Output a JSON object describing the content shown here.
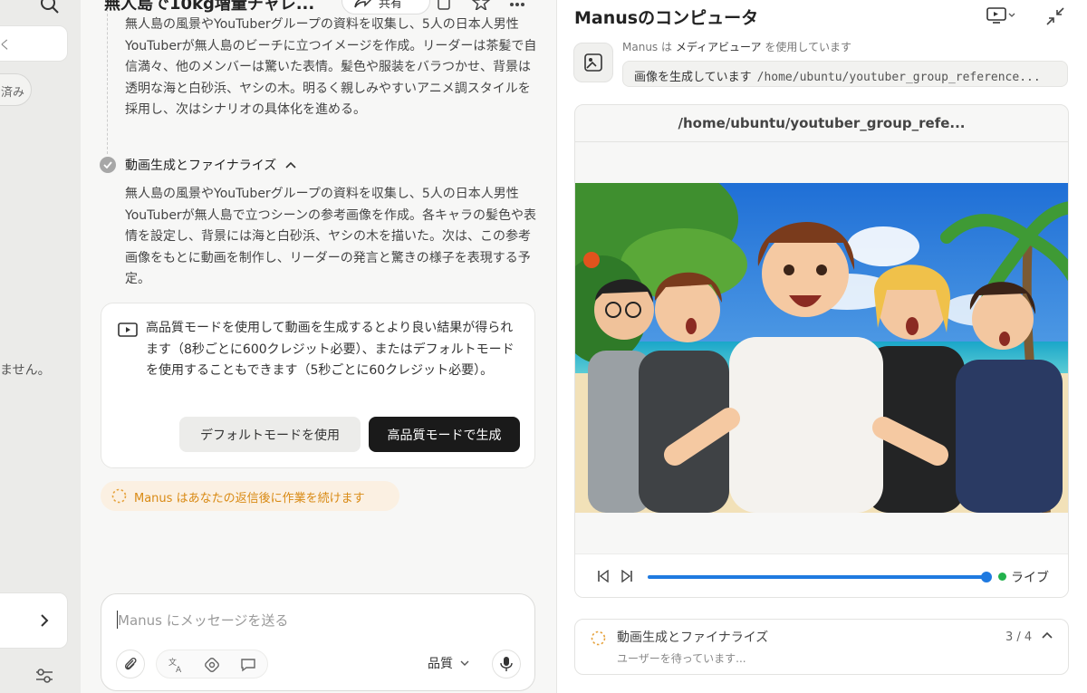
{
  "sidebar": {
    "input_fragment": "く",
    "chip_fragment": "済み",
    "empty_fragment": "ません。"
  },
  "chat": {
    "title": "無人島で10kg増量チャレ...",
    "share_label": "共有",
    "paragraph1": "無人島の風景やYouTuberグループの資料を収集し、5人の日本人男性YouTuberが無人島のビーチに立つイメージを作成。リーダーは茶髪で自信満々、他のメンバーは驚いた表情。髪色や服装をバラつかせ、背景は透明な海と白砂浜、ヤシの木。明るく親しみやすいアニメ調スタイルを採用し、次はシナリオの具体化を進める。",
    "step_label": "動画生成とファイナライズ",
    "paragraph2": "無人島の風景やYouTuberグループの資料を収集し、5人の日本人男性YouTuberが無人島で立つシーンの参考画像を作成。各キャラの髪色や表情を設定し、背景には海と白砂浜、ヤシの木を描いた。次は、この参考画像をもとに動画を制作し、リーダーの発言と驚きの様子を表現する予定。",
    "notice": {
      "text": "高品質モードを使用して動画を生成するとより良い結果が得られます（8秒ごとに600クレジット必要）、またはデフォルトモードを使用することもできます（5秒ごとに60クレジット必要）。",
      "default_button": "デフォルトモードを使用",
      "hq_button": "高品質モードで生成"
    },
    "waiting": "Manus はあなたの返信後に作業を続けます",
    "composer": {
      "placeholder": "Manus にメッセージを送る",
      "quality_label": "品質"
    }
  },
  "panel": {
    "title": "Manusのコンピュータ",
    "tool_caption_prefix": "Manus は",
    "tool_name": "メディアビューア",
    "tool_caption_suffix": "を使用しています",
    "action": "画像を生成しています",
    "path": "/home/ubuntu/youtuber_group_reference...",
    "viewer_title": "/home/ubuntu/youtuber_group_refe...",
    "playback_progress": 1.0,
    "live_label": "ライブ",
    "task": {
      "title": "動画生成とファイナライズ",
      "status": "ユーザーを待っています...",
      "count": "3 / 4"
    }
  },
  "colors": {
    "accent": "#1f7ae0",
    "live": "#22b14c",
    "waiting": "#d98a14",
    "primary_button": "#1a1a1a"
  }
}
